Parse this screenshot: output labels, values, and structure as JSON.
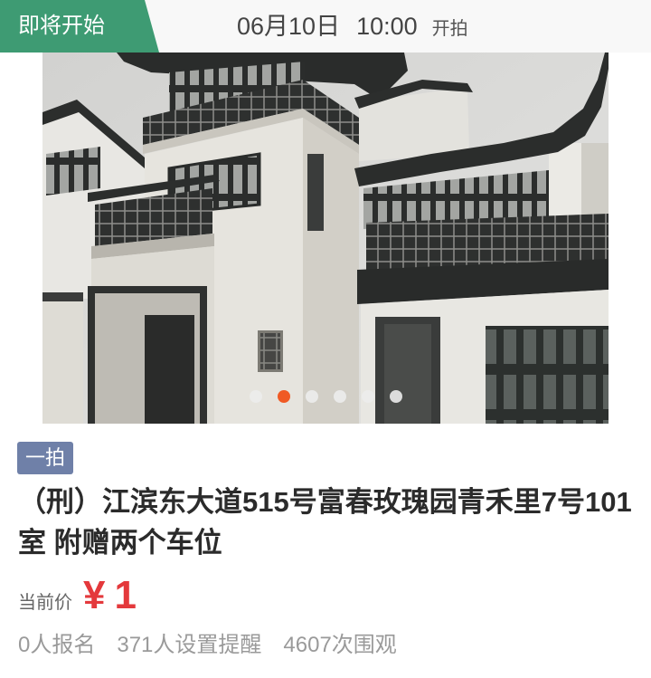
{
  "header": {
    "status_label": "即将开始",
    "status_color": "#3e9b73",
    "start_date": "06月10日",
    "start_time": "10:00",
    "start_suffix": "开拍"
  },
  "gallery": {
    "slide_count": 6,
    "active_index": 1,
    "active_dot_color": "#f05a24"
  },
  "listing": {
    "round_badge": "一拍",
    "badge_color": "#6f80a8",
    "title": "（刑）江滨东大道515号富春玫瑰园青禾里7号101室 附赠两个车位",
    "price_label": "当前价",
    "price_currency": "¥",
    "price_value": "1",
    "price_color": "#e4393c"
  },
  "stats": [
    "0人报名",
    "371人设置提醒",
    "4607次围观"
  ]
}
